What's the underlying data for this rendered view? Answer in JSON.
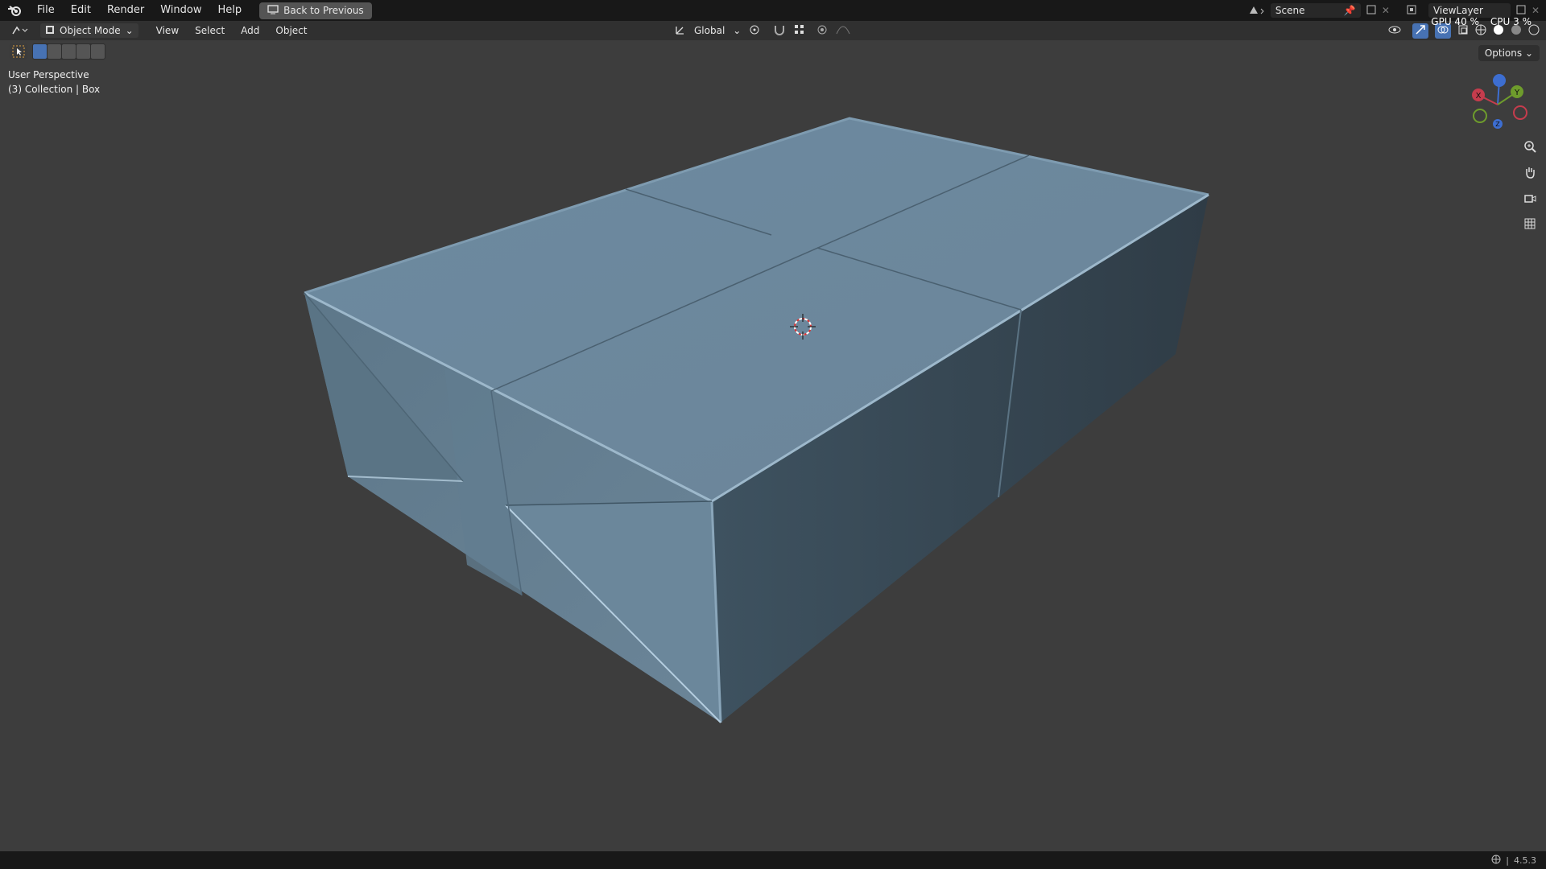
{
  "topbar": {
    "menus": [
      "File",
      "Edit",
      "Render",
      "Window",
      "Help"
    ],
    "back_button": "Back to Previous",
    "scene": "Scene",
    "view_layer": "ViewLayer"
  },
  "header": {
    "mode": "Object Mode",
    "menus": [
      "View",
      "Select",
      "Add",
      "Object"
    ],
    "transform_orientation": "Global",
    "options": "Options"
  },
  "overlay": {
    "perspective": "User Perspective",
    "collection": "(3) Collection | Box",
    "gpu": "GPU 40 %",
    "cpu": "CPU 3 %"
  },
  "gizmo": {
    "x": "X",
    "y": "Y",
    "z": "Z"
  },
  "status": {
    "version": "4.5.3"
  },
  "colors": {
    "accent": "#4772b3",
    "x_axis": "#c63c4d",
    "y_axis": "#6e9c2c",
    "z_axis": "#3d6ed1",
    "mesh": "#6d8aa0"
  }
}
